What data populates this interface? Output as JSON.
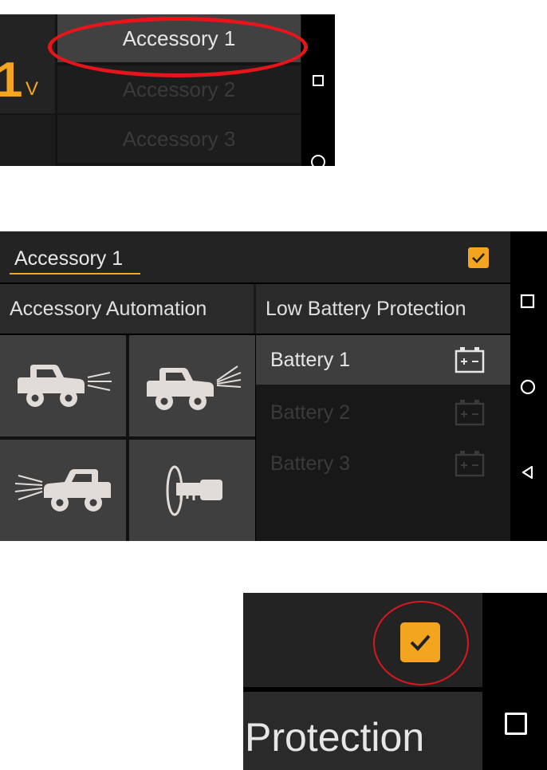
{
  "panel1": {
    "voltage_value": "1",
    "voltage_unit": "V",
    "dropdown_items": [
      "Accessory 1",
      "Accessory 2",
      "Accessory 3"
    ],
    "selected_index": 0,
    "highlight_color": "#e8141c"
  },
  "panel2": {
    "title": "Accessory 1",
    "enabled_checked": true,
    "tabs": [
      "Accessory Automation",
      "Low Battery Protection"
    ],
    "automation_icons": [
      "jeep-headlights-on-icon",
      "jeep-headlights-high-icon",
      "jeep-rear-lights-icon",
      "ignition-key-icon"
    ],
    "batteries": [
      {
        "label": "Battery 1",
        "selected": true
      },
      {
        "label": "Battery 2",
        "selected": false
      },
      {
        "label": "Battery 3",
        "selected": false
      }
    ],
    "accent_color": "#f3a51f"
  },
  "panel3": {
    "label": "Protection",
    "checkbox_checked": true
  },
  "nav_icons": [
    "recents-square-icon",
    "home-circle-icon",
    "back-triangle-icon"
  ]
}
